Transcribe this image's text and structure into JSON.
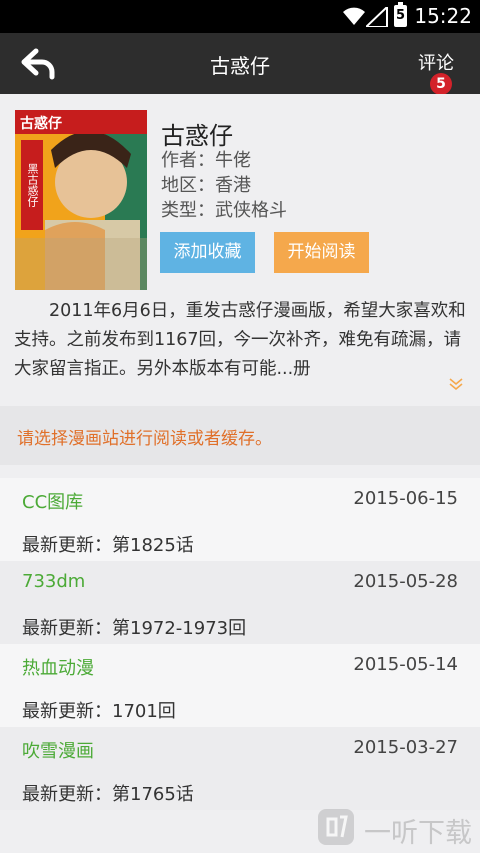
{
  "status_bar": {
    "time": "15:22",
    "battery_text": "5"
  },
  "app_bar": {
    "title": "古惑仔",
    "comment_label": "评论",
    "comment_count": "5"
  },
  "manga": {
    "title": "古惑仔",
    "author": "作者：牛佬",
    "region": "地区：香港",
    "genre": "类型：武侠格斗",
    "cover_brand": "古惑仔",
    "cover_tag": "黑古惑仔",
    "description": "2011年6月6日，重发古惑仔漫画版，希望大家喜欢和支持。之前发布到1167回，今一次补齐，难免有疏漏，请大家留言指正。另外本版本有可能...册"
  },
  "buttons": {
    "favorite": "添加收藏",
    "read": "开始阅读"
  },
  "notice": "请选择漫画站进行阅读或者缓存。",
  "sources": [
    {
      "name": "CC图库",
      "date": "2015-06-15",
      "latest": "最新更新：第1825话"
    },
    {
      "name": "733dm",
      "date": "2015-05-28",
      "latest": "最新更新：第1972-1973回"
    },
    {
      "name": "热血动漫",
      "date": "2015-05-14",
      "latest": "最新更新：1701回"
    },
    {
      "name": "吹雪漫画",
      "date": "2015-03-27",
      "latest": "最新更新：第1765话"
    }
  ],
  "watermark": {
    "text": "一听下载"
  },
  "colors": {
    "source_name": "#4caa37",
    "notice": "#e0702a",
    "favorite_btn": "#5fb3e3",
    "read_btn": "#f5a84c",
    "badge": "#d3222a"
  }
}
